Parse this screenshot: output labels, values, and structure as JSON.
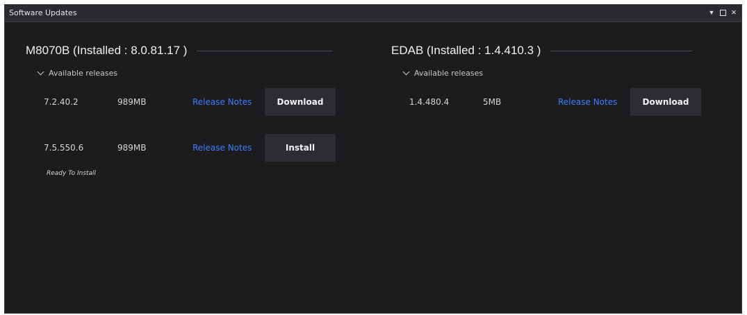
{
  "window": {
    "title": "Software Updates",
    "controls": {
      "pin_icon": "pin-down-icon",
      "maximize_icon": "maximize-icon",
      "close_icon": "close-icon"
    }
  },
  "products": [
    {
      "heading": "M8070B (Installed : 8.0.81.17 )",
      "releases_toggle_label": "Available releases",
      "releases": [
        {
          "version": "7.2.40.2",
          "size": "989MB",
          "notes_label": "Release Notes",
          "action_label": "Download",
          "status": ""
        },
        {
          "version": "7.5.550.6",
          "size": "989MB",
          "notes_label": "Release Notes",
          "action_label": "Install",
          "status": "Ready To Install"
        }
      ]
    },
    {
      "heading": "EDAB (Installed : 1.4.410.3 )",
      "releases_toggle_label": "Available releases",
      "releases": [
        {
          "version": "1.4.480.4",
          "size": "5MB",
          "notes_label": "Release Notes",
          "action_label": "Download",
          "status": ""
        }
      ]
    }
  ],
  "colors": {
    "window_bg": "#1c1c1f",
    "titlebar_bg": "#2a2a30",
    "link": "#3d7dff",
    "button_bg": "#2c2c33",
    "text": "#f0f0f0"
  }
}
